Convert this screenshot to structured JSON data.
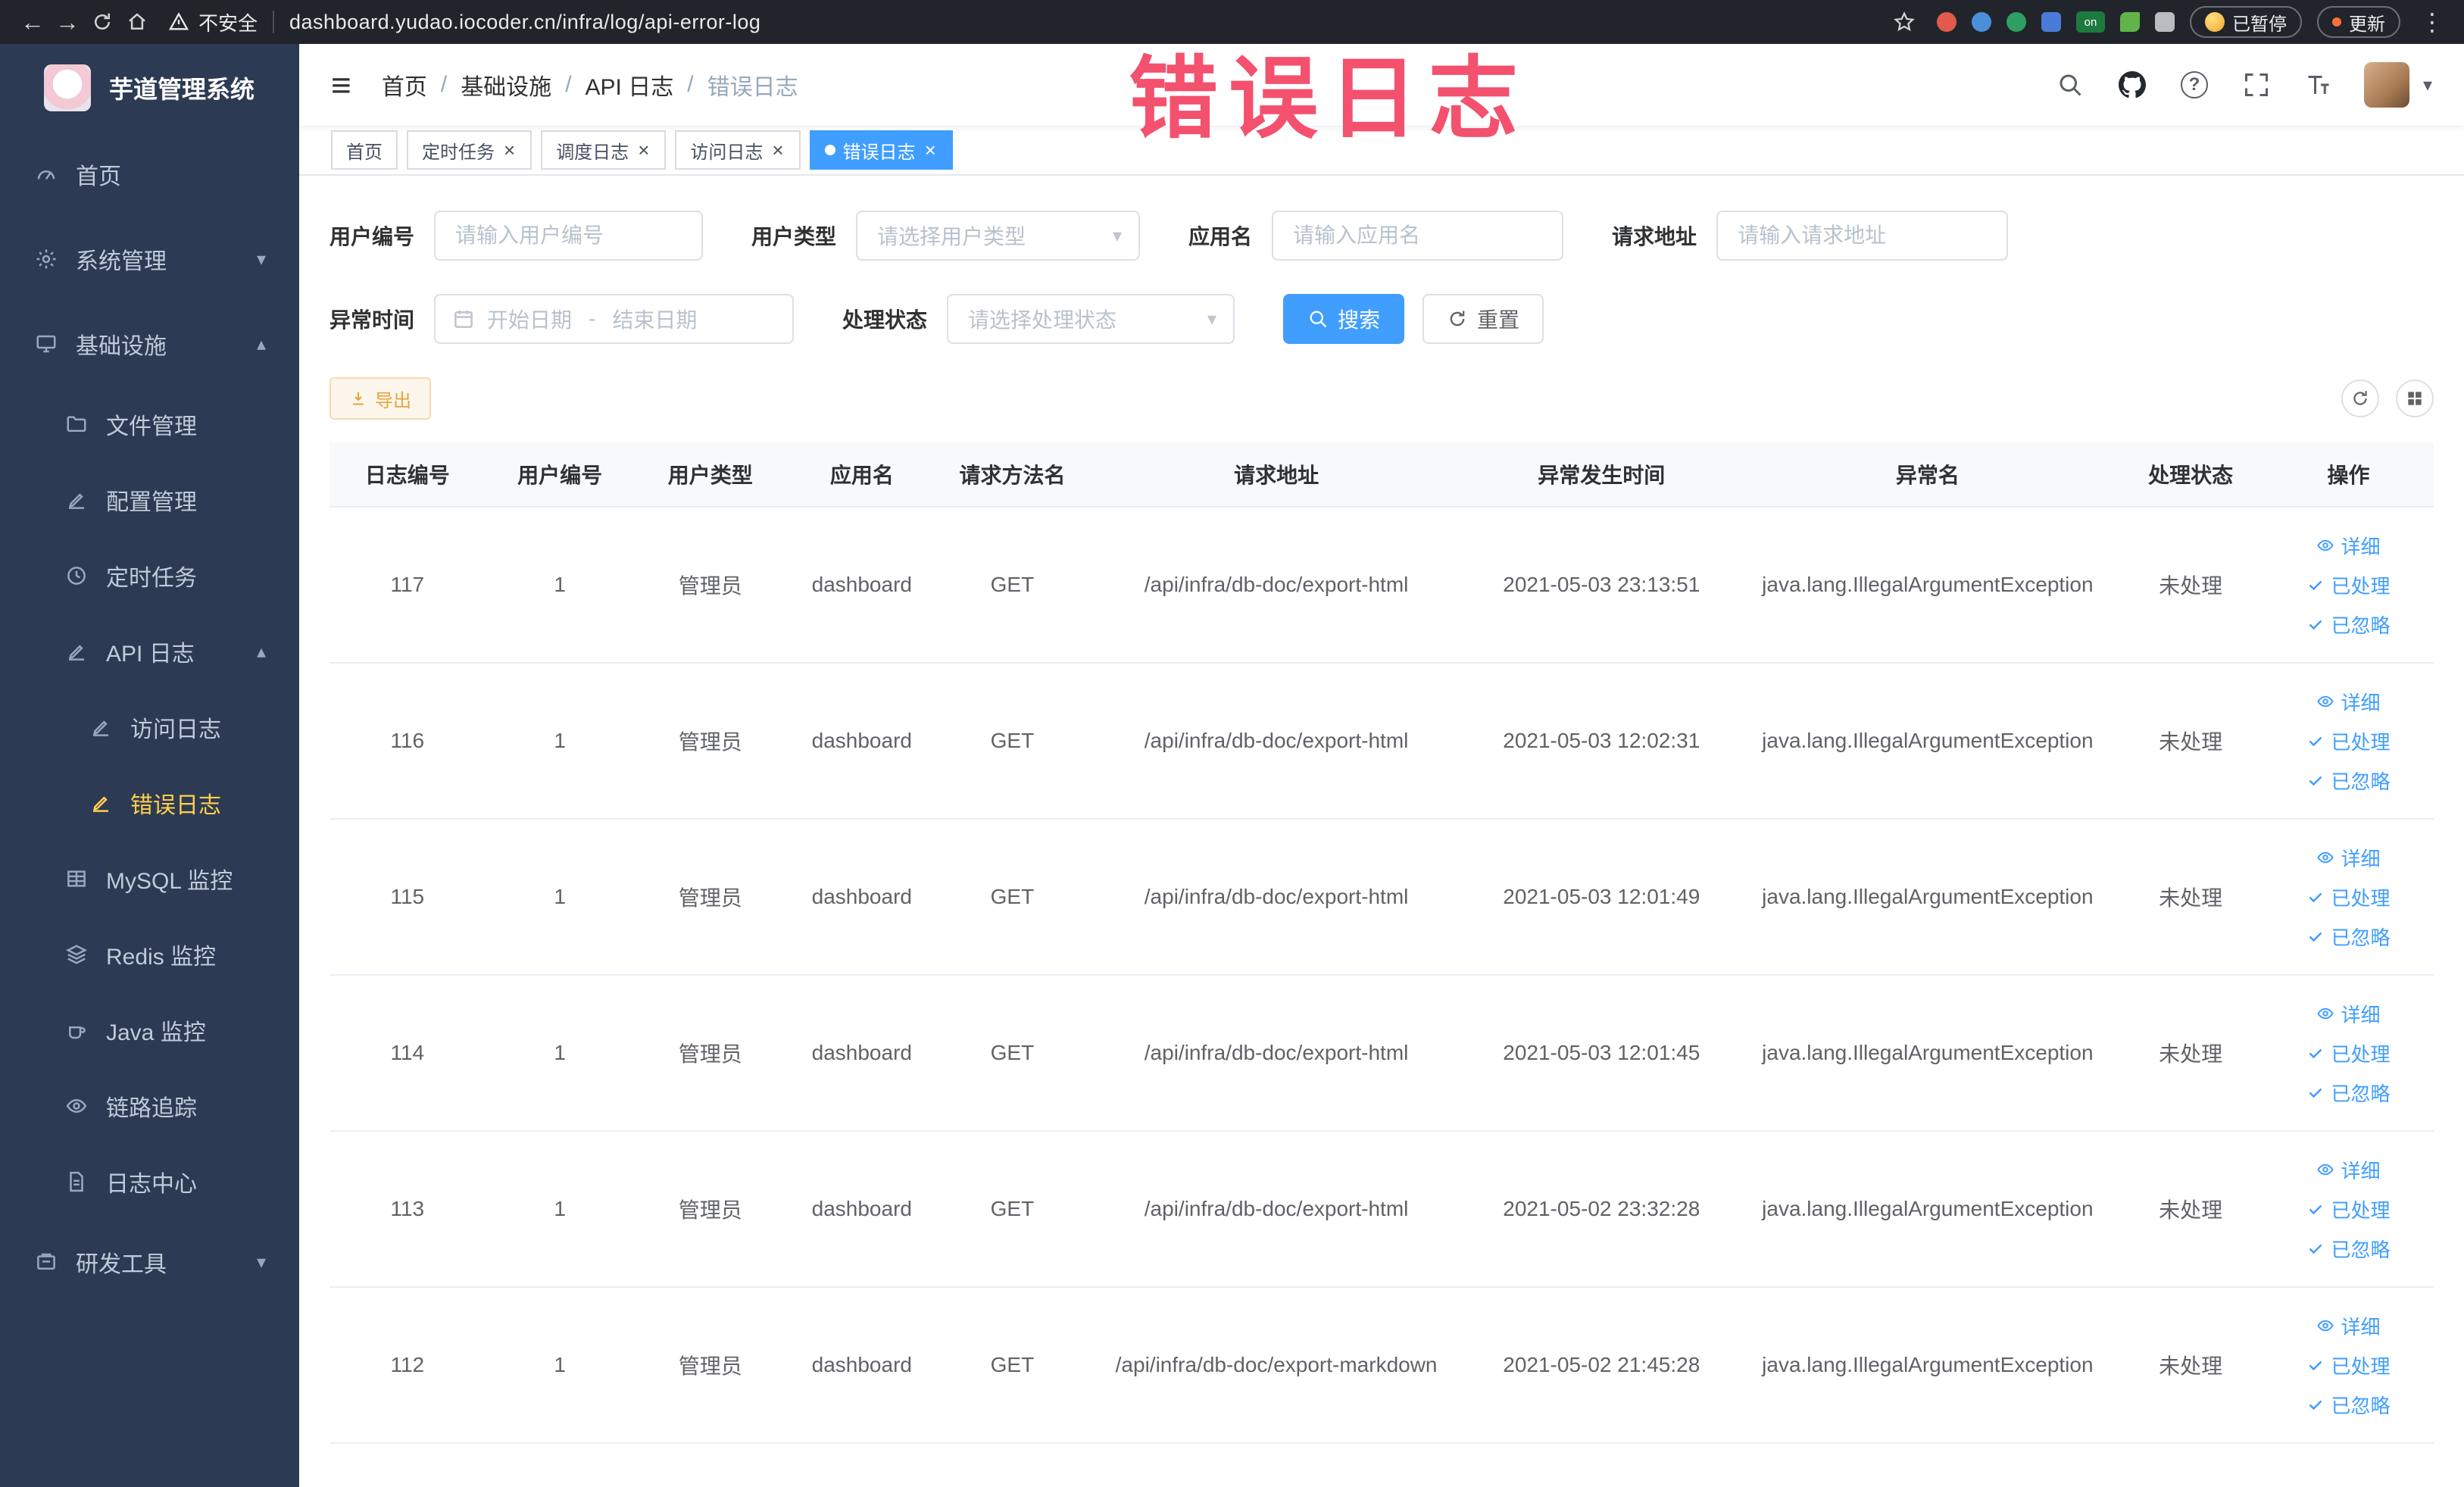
{
  "annotation": {
    "watermark_text": "错误日志"
  },
  "browser_chrome": {
    "security_label": "不安全",
    "url": "dashboard.yudao.iocoder.cn/infra/log/api-error-log",
    "paused_button": "已暂停",
    "update_button": "更新"
  },
  "sidebar": {
    "logo_title": "芋道管理系统",
    "menu": [
      {
        "name": "home",
        "label": "首页",
        "icon": "gauge-icon",
        "level": 0
      },
      {
        "name": "system-management",
        "label": "系统管理",
        "icon": "gear-icon",
        "level": 0,
        "chevron": "down"
      },
      {
        "name": "infrastructure",
        "label": "基础设施",
        "icon": "monitor-icon",
        "level": 0,
        "chevron": "up"
      },
      {
        "name": "file-management",
        "label": "文件管理",
        "icon": "folder-icon",
        "level": 1
      },
      {
        "name": "config-management",
        "label": "配置管理",
        "icon": "edit-icon",
        "level": 1
      },
      {
        "name": "scheduled-tasks",
        "label": "定时任务",
        "icon": "clock-icon",
        "level": 1
      },
      {
        "name": "api-logs",
        "label": "API 日志",
        "icon": "edit-icon",
        "level": 1,
        "chevron": "up"
      },
      {
        "name": "access-log",
        "label": "访问日志",
        "icon": "edit-icon",
        "level": 2
      },
      {
        "name": "error-log",
        "label": "错误日志",
        "icon": "edit-icon",
        "level": 2,
        "active": true
      },
      {
        "name": "mysql-monitor",
        "label": "MySQL 监控",
        "icon": "table-icon",
        "level": 1
      },
      {
        "name": "redis-monitor",
        "label": "Redis 监控",
        "icon": "stack-icon",
        "level": 1
      },
      {
        "name": "java-monitor",
        "label": "Java 监控",
        "icon": "coffee-icon",
        "level": 1
      },
      {
        "name": "tracing",
        "label": "链路追踪",
        "icon": "eye-icon",
        "level": 1
      },
      {
        "name": "log-center",
        "label": "日志中心",
        "icon": "doc-icon",
        "level": 1
      },
      {
        "name": "dev-tools",
        "label": "研发工具",
        "icon": "tool-icon",
        "level": 0,
        "chevron": "down"
      }
    ]
  },
  "navbar": {
    "breadcrumb": [
      "首页",
      "基础设施",
      "API 日志",
      "错误日志"
    ]
  },
  "tabs": [
    {
      "name": "home",
      "label": "首页",
      "closable": false,
      "active": false
    },
    {
      "name": "scheduled-tasks",
      "label": "定时任务",
      "closable": true,
      "active": false
    },
    {
      "name": "schedule-log",
      "label": "调度日志",
      "closable": true,
      "active": false
    },
    {
      "name": "access-log",
      "label": "访问日志",
      "closable": true,
      "active": false
    },
    {
      "name": "error-log",
      "label": "错误日志",
      "closable": true,
      "active": true
    }
  ],
  "filters": {
    "user_id": {
      "label": "用户编号",
      "placeholder": "请输入用户编号",
      "value": ""
    },
    "user_type": {
      "label": "用户类型",
      "placeholder": "请选择用户类型",
      "value": ""
    },
    "app_name": {
      "label": "应用名",
      "placeholder": "请输入应用名",
      "value": ""
    },
    "request_url": {
      "label": "请求地址",
      "placeholder": "请输入请求地址",
      "value": ""
    },
    "exception_time": {
      "label": "异常时间",
      "start_placeholder": "开始日期",
      "separator": "-",
      "end_placeholder": "结束日期"
    },
    "process_status": {
      "label": "处理状态",
      "placeholder": "请选择处理状态",
      "value": ""
    },
    "search_button": "搜索",
    "reset_button": "重置"
  },
  "toolbar": {
    "export_button": "导出"
  },
  "table": {
    "columns": [
      "日志编号",
      "用户编号",
      "用户类型",
      "应用名",
      "请求方法名",
      "请求地址",
      "异常发生时间",
      "异常名",
      "处理状态",
      "操作"
    ],
    "rows": [
      {
        "log_id": "117",
        "user_id": "1",
        "user_type": "管理员",
        "app_name": "dashboard",
        "method": "GET",
        "url": "/api/infra/db-doc/export-html",
        "time": "2021-05-03 23:13:51",
        "exception": "java.lang.IllegalArgumentException",
        "status": "未处理"
      },
      {
        "log_id": "116",
        "user_id": "1",
        "user_type": "管理员",
        "app_name": "dashboard",
        "method": "GET",
        "url": "/api/infra/db-doc/export-html",
        "time": "2021-05-03 12:02:31",
        "exception": "java.lang.IllegalArgumentException",
        "status": "未处理"
      },
      {
        "log_id": "115",
        "user_id": "1",
        "user_type": "管理员",
        "app_name": "dashboard",
        "method": "GET",
        "url": "/api/infra/db-doc/export-html",
        "time": "2021-05-03 12:01:49",
        "exception": "java.lang.IllegalArgumentException",
        "status": "未处理"
      },
      {
        "log_id": "114",
        "user_id": "1",
        "user_type": "管理员",
        "app_name": "dashboard",
        "method": "GET",
        "url": "/api/infra/db-doc/export-html",
        "time": "2021-05-03 12:01:45",
        "exception": "java.lang.IllegalArgumentException",
        "status": "未处理"
      },
      {
        "log_id": "113",
        "user_id": "1",
        "user_type": "管理员",
        "app_name": "dashboard",
        "method": "GET",
        "url": "/api/infra/db-doc/export-html",
        "time": "2021-05-02 23:32:28",
        "exception": "java.lang.IllegalArgumentException",
        "status": "未处理"
      },
      {
        "log_id": "112",
        "user_id": "1",
        "user_type": "管理员",
        "app_name": "dashboard",
        "method": "GET",
        "url": "/api/infra/db-doc/export-markdown",
        "time": "2021-05-02 21:45:28",
        "exception": "java.lang.IllegalArgumentException",
        "status": "未处理"
      }
    ],
    "row_actions": [
      {
        "name": "detail",
        "label": "详细",
        "icon": "eye-icon"
      },
      {
        "name": "mark-processed",
        "label": "已处理",
        "icon": "check-icon"
      },
      {
        "name": "mark-ignored",
        "label": "已忽略",
        "icon": "check-icon"
      }
    ]
  }
}
